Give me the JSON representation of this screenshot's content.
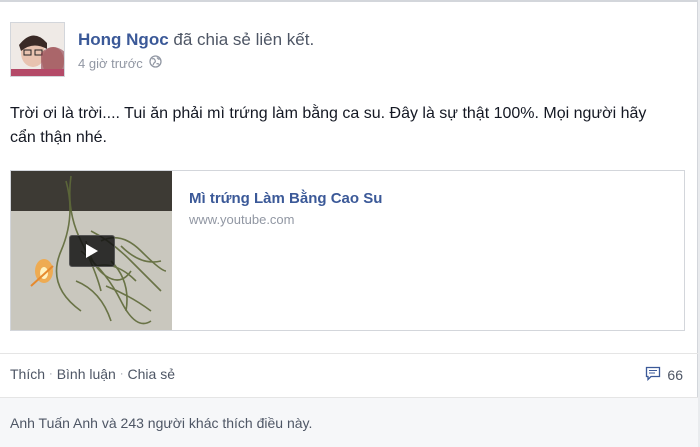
{
  "author": {
    "name": "Hong Ngoc",
    "action": "đã chia sẻ liên kết."
  },
  "meta": {
    "time": "4 giờ trước",
    "privacy_icon": "globe-icon"
  },
  "post": {
    "text": "Trời ơi là trời.... Tui ăn phải mì trứng làm bằng ca su. Đây là sự thật 100%. Mọi người hãy cẩn thận nhé."
  },
  "link": {
    "title": "Mì trứng Làm Bằng Cao Su",
    "domain": "www.youtube.com",
    "thumbnail_icon": "play-icon"
  },
  "actions": {
    "like": "Thích",
    "comment": "Bình luận",
    "share": "Chia sẻ",
    "separator": "·"
  },
  "comments": {
    "count": "66",
    "icon": "comment-icon"
  },
  "likes": {
    "summary": "Anh Tuấn Anh và 243 người khác thích điều này."
  },
  "colors": {
    "link_blue": "#3b5998",
    "meta_gray": "#9197a3",
    "text": "#141823"
  }
}
